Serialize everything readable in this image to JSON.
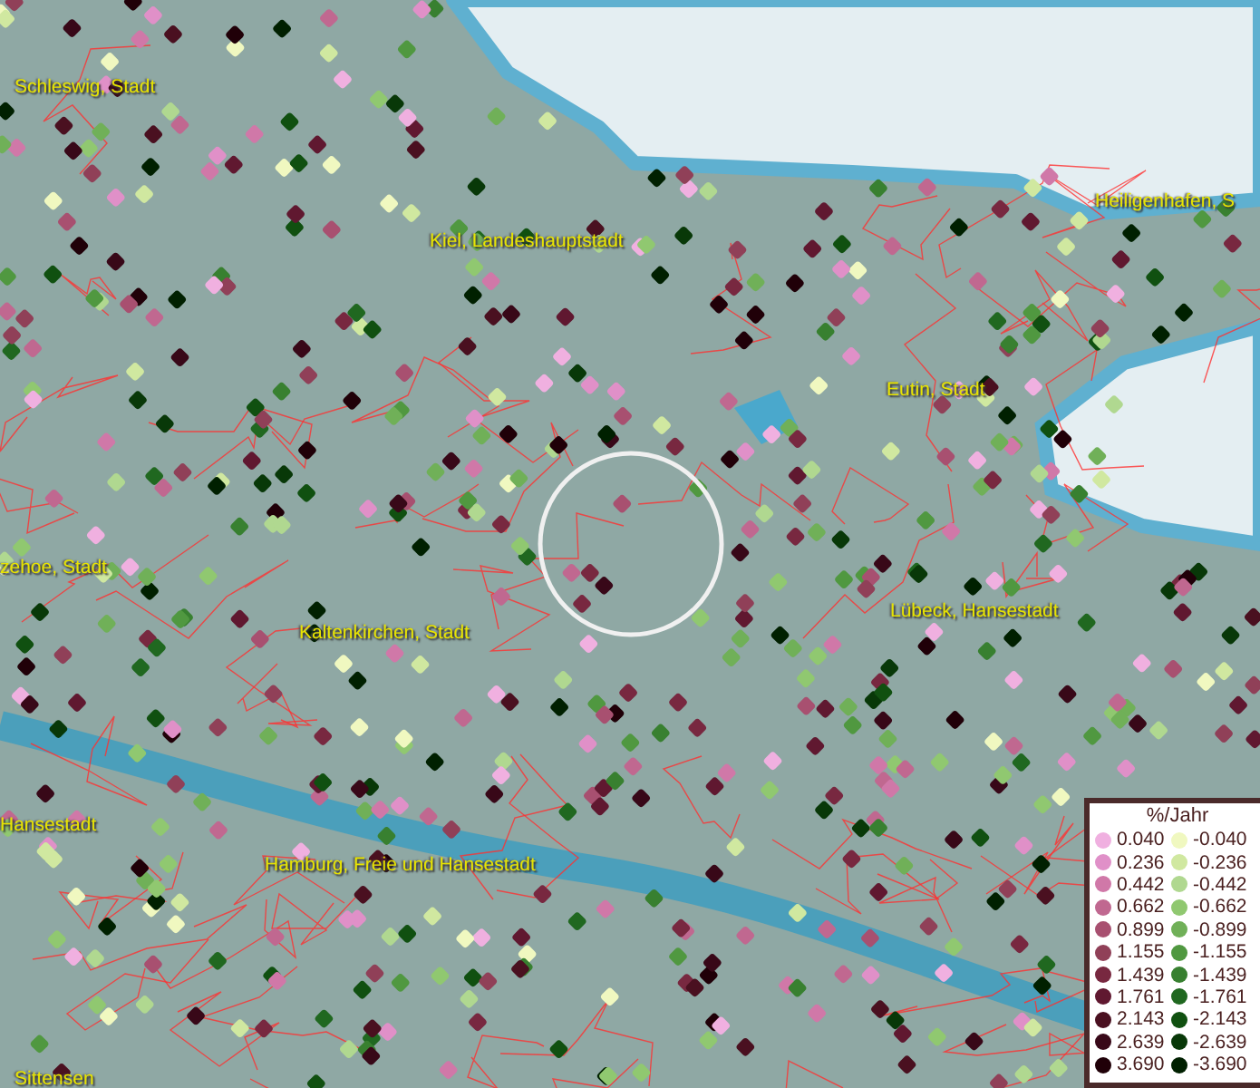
{
  "places": [
    {
      "name": "Schleswig, Stadt"
    },
    {
      "name": "Kiel, Landeshauptstadt"
    },
    {
      "name": "Heiligenhafen, S"
    },
    {
      "name": "Eutin, Stadt"
    },
    {
      "name": "zehoe, Stadt"
    },
    {
      "name": "Kaltenkirchen, Stadt"
    },
    {
      "name": "Lübeck, Hansestadt"
    },
    {
      "name": "Hansestadt"
    },
    {
      "name": "Hamburg, Freie und Hansestadt"
    },
    {
      "name": "Sittensen"
    }
  ],
  "legend": {
    "title": "%/Jahr",
    "items": [
      {
        "label": "0.040",
        "color": "#f0b0e0"
      },
      {
        "label": "-0.040",
        "color": "#f0f8c0"
      },
      {
        "label": "0.236",
        "color": "#e090c8"
      },
      {
        "label": "-0.236",
        "color": "#d0e8a0"
      },
      {
        "label": "0.442",
        "color": "#d078a8"
      },
      {
        "label": "-0.442",
        "color": "#b0d890"
      },
      {
        "label": "0.662",
        "color": "#c06890"
      },
      {
        "label": "-0.662",
        "color": "#90c870"
      },
      {
        "label": "0.899",
        "color": "#a85070"
      },
      {
        "label": "-0.899",
        "color": "#70b058"
      },
      {
        "label": "1.155",
        "color": "#904058"
      },
      {
        "label": "-1.155",
        "color": "#509840"
      },
      {
        "label": "1.439",
        "color": "#782840"
      },
      {
        "label": "-1.439",
        "color": "#388030"
      },
      {
        "label": "1.761",
        "color": "#601830"
      },
      {
        "label": "-1.761",
        "color": "#206820"
      },
      {
        "label": "2.143",
        "color": "#4a1020"
      },
      {
        "label": "-2.143",
        "color": "#105010"
      },
      {
        "label": "2.639",
        "color": "#380818"
      },
      {
        "label": "-2.639",
        "color": "#083808"
      },
      {
        "label": "3.690",
        "color": "#200008"
      },
      {
        "label": "-3.690",
        "color": "#002000"
      }
    ]
  }
}
